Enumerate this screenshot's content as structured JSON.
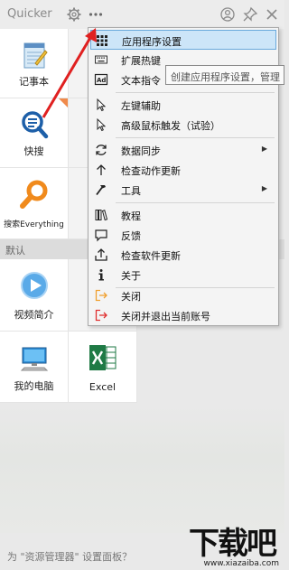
{
  "window": {
    "title": "Quicker",
    "settings_icon": "gear-icon",
    "more_icon": "ellipsis-icon",
    "account_icon": "user-circle-icon",
    "pin_icon": "pin-icon",
    "close_icon": "close-icon"
  },
  "tiles_top": [
    {
      "label": "记事本",
      "icon": "notepad-icon"
    },
    {
      "label": "快搜",
      "icon": "search-icon"
    },
    {
      "label": "搜索Everything",
      "icon": "everything-search-icon"
    }
  ],
  "section": {
    "label": "默认"
  },
  "tiles_default": [
    {
      "label": "视频简介",
      "icon": "play-icon"
    },
    {
      "label": "我的电脑",
      "icon": "computer-icon"
    },
    {
      "label": "Excel",
      "icon": "excel-icon"
    }
  ],
  "menu": {
    "items": [
      {
        "label": "应用程序设置",
        "icon": "grid-icon",
        "active": true
      },
      {
        "label": "扩展热键",
        "icon": "keyboard-icon"
      },
      {
        "label": "文本指令",
        "icon": "ad-icon"
      },
      {
        "label": "左键辅助",
        "icon": "cursor-icon"
      },
      {
        "label": "高级鼠标触发（试验）",
        "icon": "cursor-icon"
      },
      {
        "label": "数据同步",
        "icon": "sync-icon",
        "submenu": true
      },
      {
        "label": "检查动作更新",
        "icon": "up-arrow-icon"
      },
      {
        "label": "工具",
        "icon": "hammer-icon",
        "submenu": true
      },
      {
        "label": "教程",
        "icon": "books-icon"
      },
      {
        "label": "反馈",
        "icon": "chat-bubble-icon"
      },
      {
        "label": "检查软件更新",
        "icon": "upload-icon"
      },
      {
        "label": "关于",
        "icon": "info-icon"
      },
      {
        "label": "关闭",
        "icon": "exit-icon"
      },
      {
        "label": "关闭并退出当前账号",
        "icon": "logout-icon"
      }
    ]
  },
  "tooltip": {
    "text": "创建应用程序设置，管理"
  },
  "bottom_hint": "为 \"资源管理器\" 设置面板？",
  "watermark": {
    "main": "下载吧",
    "sub": "www.xiazaiba.com"
  },
  "colors": {
    "menu_highlight": "#cce5f8",
    "menu_highlight_border": "#69a9dc",
    "annotation_arrow": "#e02020",
    "exit_icon": "#f0a030",
    "logout_icon": "#e03030"
  }
}
